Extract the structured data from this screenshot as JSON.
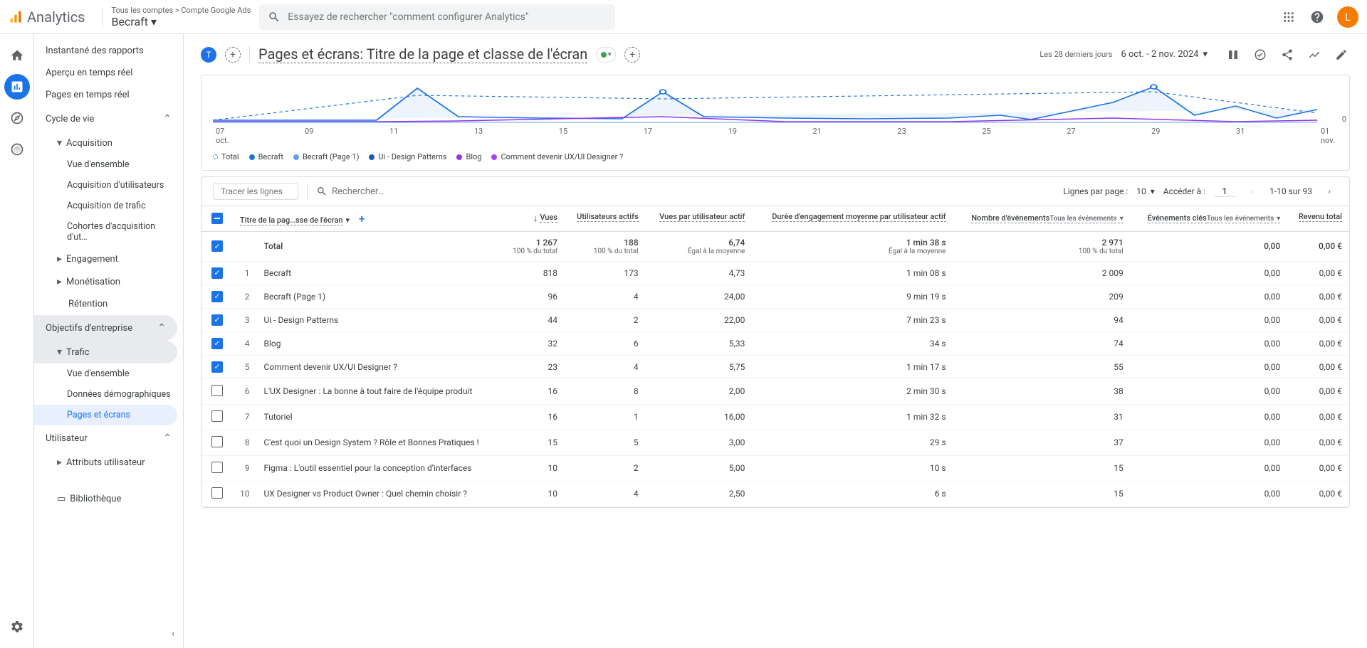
{
  "header": {
    "product": "Analytics",
    "breadcrumb": "Tous les comptes > Compte Google Ads",
    "account": "Becraft",
    "search_placeholder": "Essayez de rechercher \"comment configurer Analytics\"",
    "avatar_initial": "L"
  },
  "sidebar": {
    "items": {
      "snapshot": "Instantané des rapports",
      "realtime_overview": "Aperçu en temps réel",
      "realtime_pages": "Pages en temps réel"
    },
    "lifecycle": {
      "label": "Cycle de vie",
      "acquisition": {
        "label": "Acquisition",
        "overview": "Vue d'ensemble",
        "user_acq": "Acquisition d'utilisateurs",
        "traffic_acq": "Acquisition de trafic",
        "cohorts": "Cohortes d'acquisition d'ut…"
      },
      "engagement": "Engagement",
      "monetization": "Monétisation",
      "retention": "Rétention"
    },
    "business": {
      "label": "Objectifs d'entreprise",
      "traffic": {
        "label": "Trafic",
        "overview": "Vue d'ensemble",
        "demographics": "Données démographiques",
        "pages": "Pages et écrans"
      }
    },
    "user": {
      "label": "Utilisateur",
      "attributes": "Attributs utilisateur"
    },
    "library": "Bibliothèque"
  },
  "page": {
    "badge": "T",
    "title": "Pages et écrans: Titre de la page et classe de l'écran",
    "date_label": "Les 28 derniers jours",
    "date_range": "6 oct. - 2 nov. 2024"
  },
  "chart_data": {
    "type": "line",
    "xlabel": "",
    "ylabel": "",
    "ylim": [
      0,
      80
    ],
    "x_ticks": [
      "07\noct.",
      "09",
      "11",
      "13",
      "15",
      "17",
      "19",
      "21",
      "23",
      "25",
      "27",
      "29",
      "31",
      "01\nnov."
    ],
    "y_tick_visible": "0",
    "series": [
      {
        "name": "Total",
        "color": "#1a73e8",
        "dashed": true
      },
      {
        "name": "Becraft",
        "color": "#1a73e8"
      },
      {
        "name": "Becraft (Page 1)",
        "color": "#669df6"
      },
      {
        "name": "Ui - Design Patterns",
        "color": "#185abc"
      },
      {
        "name": "Blog",
        "color": "#9334e6"
      },
      {
        "name": "Comment devenir UX/UI Designer ?",
        "color": "#a142f4"
      }
    ]
  },
  "table_toolbar": {
    "trace_placeholder": "Tracer les lignes",
    "search_placeholder": "Rechercher…",
    "rows_label": "Lignes par page :",
    "rows_value": "10",
    "goto_label": "Accéder à :",
    "goto_value": "1",
    "range": "1-10 sur 93"
  },
  "table": {
    "columns": {
      "name": "Titre de la pag…sse de l'écran",
      "views": "Vues",
      "active_users": "Utilisateurs actifs",
      "views_per_user": "Vues par utilisateur actif",
      "avg_engagement": "Durée d'engagement moyenne par utilisateur actif",
      "events": "Nombre d'événements",
      "key_events": "Événements clés",
      "revenue": "Revenu total",
      "all_events": "Tous les événements"
    },
    "total": {
      "label": "Total",
      "views": "1 267",
      "views_sub": "100 % du total",
      "users": "188",
      "users_sub": "100 % du total",
      "vpu": "6,74",
      "vpu_sub": "Égal à la moyenne",
      "eng": "1 min 38 s",
      "eng_sub": "Égal à la moyenne",
      "events": "2 971",
      "events_sub": "100 % du total",
      "key": "0,00",
      "revenue": "0,00 €"
    },
    "rows": [
      {
        "checked": true,
        "idx": "1",
        "name": "Becraft",
        "views": "818",
        "users": "173",
        "vpu": "4,73",
        "eng": "1 min 08 s",
        "events": "2 009",
        "key": "0,00",
        "rev": "0,00 €"
      },
      {
        "checked": true,
        "idx": "2",
        "name": "Becraft (Page 1)",
        "views": "96",
        "users": "4",
        "vpu": "24,00",
        "eng": "9 min 19 s",
        "events": "209",
        "key": "0,00",
        "rev": "0,00 €"
      },
      {
        "checked": true,
        "idx": "3",
        "name": "Ui - Design Patterns",
        "views": "44",
        "users": "2",
        "vpu": "22,00",
        "eng": "7 min 23 s",
        "events": "94",
        "key": "0,00",
        "rev": "0,00 €"
      },
      {
        "checked": true,
        "idx": "4",
        "name": "Blog",
        "views": "32",
        "users": "6",
        "vpu": "5,33",
        "eng": "34 s",
        "events": "74",
        "key": "0,00",
        "rev": "0,00 €"
      },
      {
        "checked": true,
        "idx": "5",
        "name": "Comment devenir UX/UI Designer ?",
        "views": "23",
        "users": "4",
        "vpu": "5,75",
        "eng": "1 min 17 s",
        "events": "55",
        "key": "0,00",
        "rev": "0,00 €"
      },
      {
        "checked": false,
        "idx": "6",
        "name": "L'UX Designer : La bonne à tout faire de l'équipe produit",
        "views": "16",
        "users": "8",
        "vpu": "2,00",
        "eng": "2 min 30 s",
        "events": "38",
        "key": "0,00",
        "rev": "0,00 €"
      },
      {
        "checked": false,
        "idx": "7",
        "name": "Tutoriel",
        "views": "16",
        "users": "1",
        "vpu": "16,00",
        "eng": "1 min 32 s",
        "events": "31",
        "key": "0,00",
        "rev": "0,00 €"
      },
      {
        "checked": false,
        "idx": "8",
        "name": "C'est quoi un Design System ? Rôle et Bonnes Pratiques !",
        "views": "15",
        "users": "5",
        "vpu": "3,00",
        "eng": "29 s",
        "events": "37",
        "key": "0,00",
        "rev": "0,00 €"
      },
      {
        "checked": false,
        "idx": "9",
        "name": "Figma : L'outil essentiel pour la conception d'interfaces",
        "views": "10",
        "users": "2",
        "vpu": "5,00",
        "eng": "10 s",
        "events": "15",
        "key": "0,00",
        "rev": "0,00 €"
      },
      {
        "checked": false,
        "idx": "10",
        "name": "UX Designer vs Product Owner : Quel chemin choisir ?",
        "views": "10",
        "users": "4",
        "vpu": "2,50",
        "eng": "6 s",
        "events": "15",
        "key": "0,00",
        "rev": "0,00 €"
      }
    ]
  }
}
